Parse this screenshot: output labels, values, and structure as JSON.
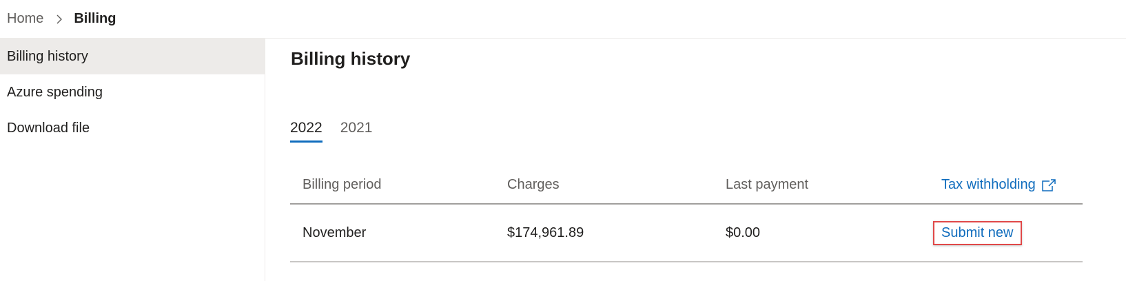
{
  "breadcrumb": {
    "home": "Home",
    "current": "Billing"
  },
  "sidebar": {
    "items": [
      {
        "label": "Billing history",
        "active": true
      },
      {
        "label": "Azure spending",
        "active": false
      },
      {
        "label": "Download file",
        "active": false
      }
    ]
  },
  "main": {
    "title": "Billing history",
    "tabs": [
      {
        "label": "2022",
        "active": true
      },
      {
        "label": "2021",
        "active": false
      }
    ],
    "table": {
      "headers": {
        "period": "Billing period",
        "charges": "Charges",
        "last_payment": "Last payment",
        "tax_link": "Tax withholding"
      },
      "rows": [
        {
          "period": "November",
          "charges": "$174,961.89",
          "last_payment": "$0.00",
          "action": "Submit new"
        }
      ]
    }
  },
  "colors": {
    "accent": "#0f6cbd",
    "highlight_border": "#e04848",
    "active_nav_bg": "#edebe9"
  },
  "icons": {
    "breadcrumb_separator": "chevron-right-icon",
    "tax_link": "external-link-icon"
  }
}
